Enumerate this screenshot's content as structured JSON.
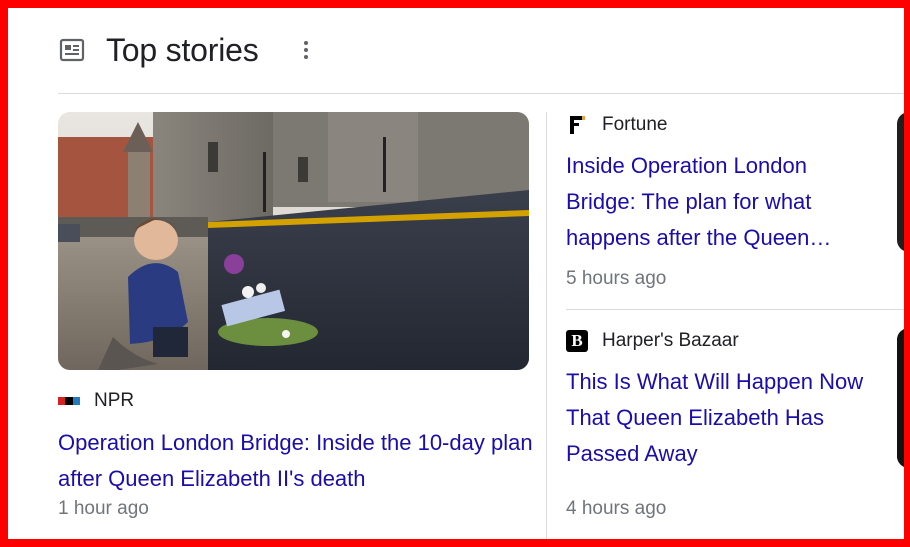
{
  "header": {
    "title": "Top stories",
    "icon": "newspaper-icon",
    "more_icon": "more-vert-icon"
  },
  "main_story": {
    "source": "NPR",
    "headline": "Operation London Bridge: Inside the 10-day plan after Queen Elizabeth II's death",
    "time": "1 hour ago"
  },
  "side_stories": [
    {
      "source": "Fortune",
      "logo_letter": "F",
      "headline": "Inside Operation London Bridge: The plan for what happens after the Queen…",
      "time": "5 hours ago"
    },
    {
      "source": "Harper's Bazaar",
      "logo_letter": "B",
      "headline": "This Is What Will Happen Now That Queen Elizabeth Has Passed Away",
      "time": "4 hours ago"
    }
  ],
  "colors": {
    "link": "#1a0dab",
    "meta": "#70757a",
    "text": "#202124",
    "frame": "#ff0000",
    "divider": "#dadce0"
  }
}
